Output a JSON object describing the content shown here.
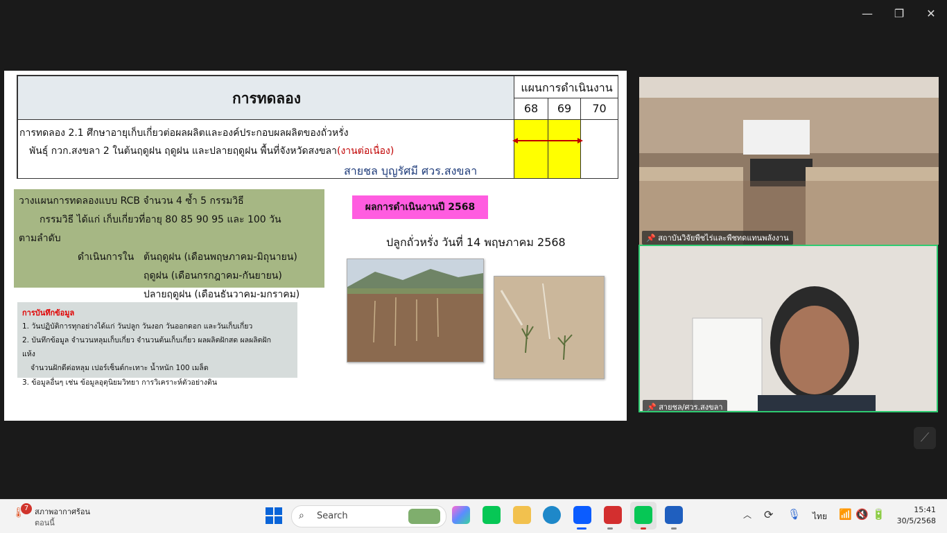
{
  "slide": {
    "header": {
      "title": "การทดลอง",
      "plan_title": "แผนการดำเนินงาน",
      "years": [
        "68",
        "69",
        "70"
      ]
    },
    "experiment": {
      "line1": "การทดลอง 2.1  ศึกษาอายุเก็บเกี่ยวต่อผลผลิตและองค์ประกอบผลผลิตของถั่วหรั่ง",
      "line2_main": "พันธุ์ กวก.สงขลา 2 ในต้นฤดูฝน ฤดูฝน และปลายฤดูฝน พื้นที่จังหวัดสงขลา",
      "line2_red": "(งานต่อเนื่อง)",
      "author": "สายชล บุญรัศมี  ศวร.สงขลา"
    },
    "design": {
      "line1": "วางแผนการทดลองแบบ RCB จำนวน 4 ซ้ำ 5 กรรมวิธี",
      "line2": "กรรมวิธี ได้แก่ เก็บเกี่ยวที่อายุ 80 85 90 95 และ 100 วัน",
      "line3": "ตามลำดับ",
      "line4_label": "ดำเนินการใน",
      "season1": "ต้นฤดูฝน (เดือนพฤษภาคม-มิถุนายน)",
      "season2": "ฤดูฝน (เดือนกรกฎาคม-กันยายน)",
      "season3": "ปลายฤดูฝน (เดือนธันวาคม-มกราคม)"
    },
    "records": {
      "title": "การบันทึกข้อมูล",
      "item1": "1. วันปฏิบัติการทุกอย่างได้แก่ วันปลูก วันงอก วันออกดอก และวันเก็บเกี่ยว",
      "item2a": "2. บันทึกข้อมูล จำนวนหลุมเก็บเกี่ยว จำนวนต้นเก็บเกี่ยว ผลผลิตฝักสด ผลผลิตฝัก",
      "item2b": "แห้ง",
      "item2c": "จำนวนฝักดีต่อหลุม เปอร์เซ็นต์กะเทาะ น้ำหนัก 100 เมล็ด",
      "item3": "3. ข้อมูลอื่นๆ เช่น ข้อมูลอุตุนิยมวิทยา การวิเคราะห์ตัวอย่างดิน"
    },
    "results": {
      "badge": "ผลการดำเนินงานปี 2568",
      "planting": "ปลูกถั่วหรั่ง วันที่ 14 พฤษภาคม 2568"
    }
  },
  "participants": {
    "room": "สถาบันวิจัยพืชไร่และพืชทดแทนพลังงาน",
    "speaker": "สายชล/ศวร.สงขลา"
  },
  "taskbar": {
    "weather_badge": "7",
    "weather_title": "สภาพอากาศร้อน",
    "weather_sub": "ตอนนี้",
    "search_placeholder": "Search",
    "lang": "ไทย",
    "time": "15:41",
    "date": "30/5/2568"
  },
  "colors": {
    "highlight_yellow": "#ffff00",
    "badge_pink": "#ff5ce0",
    "design_green": "#a6b784",
    "records_gray": "#d6dcdb",
    "active_speaker_border": "#2ecc71",
    "arrow_red": "#c00000"
  }
}
